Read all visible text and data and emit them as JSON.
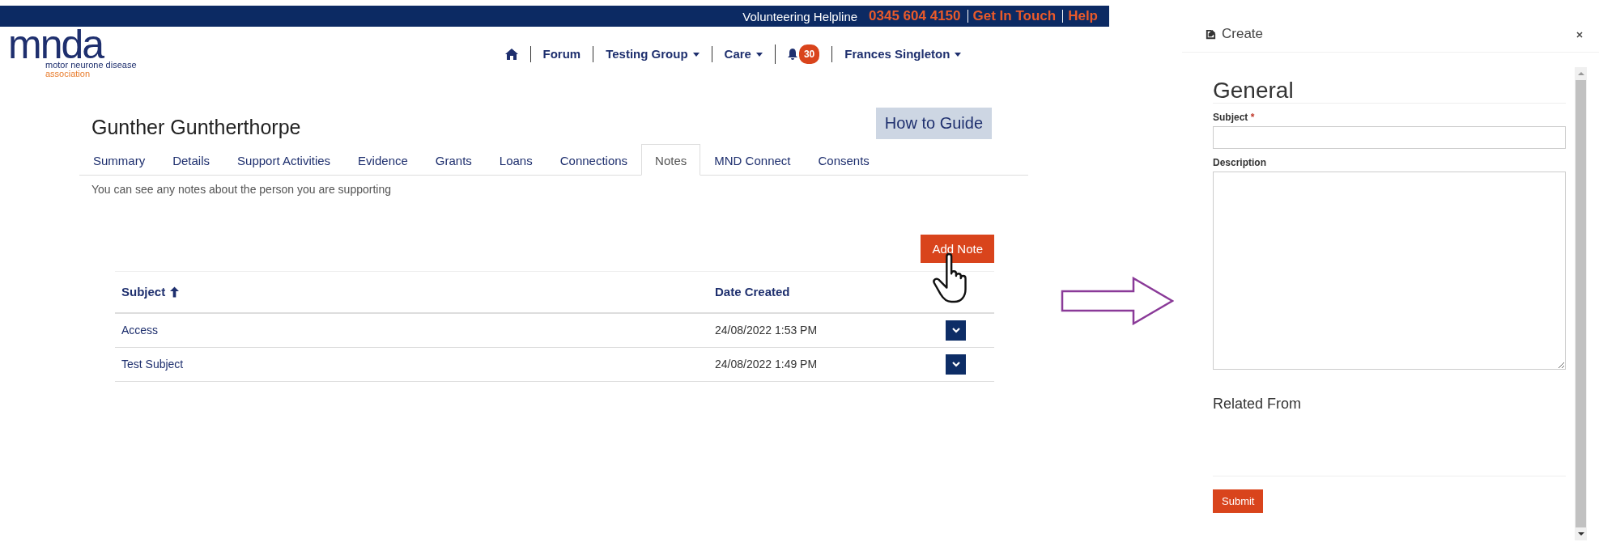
{
  "top_bar": {
    "helpline_label": "Volunteering Helpline",
    "phone": "0345 604 4150",
    "links": [
      "Get In Touch",
      "Help"
    ]
  },
  "logo": {
    "wordmark": "mnda",
    "tagline": [
      "motor neurone disease",
      "association"
    ]
  },
  "nav": [
    {
      "kind": "home"
    },
    {
      "kind": "link",
      "label": "Forum"
    },
    {
      "kind": "dropdown",
      "label": "Testing Group"
    },
    {
      "kind": "dropdown",
      "label": "Care"
    },
    {
      "kind": "notifications",
      "badge": "30"
    },
    {
      "kind": "dropdown",
      "label": "Frances Singleton"
    }
  ],
  "page": {
    "title": "Gunther Guntherthorpe",
    "guide_button": "How to Guide",
    "tabs": [
      {
        "label": "Summary",
        "selected": false
      },
      {
        "label": "Details",
        "selected": false
      },
      {
        "label": "Support Activities",
        "selected": false
      },
      {
        "label": "Evidence",
        "selected": false
      },
      {
        "label": "Grants",
        "selected": false
      },
      {
        "label": "Loans",
        "selected": false
      },
      {
        "label": "Connections",
        "selected": false
      },
      {
        "label": "Notes",
        "selected": true
      },
      {
        "label": "MND Connect",
        "selected": false
      },
      {
        "label": "Consents",
        "selected": false
      }
    ],
    "intro": "You can see any notes about the person you are supporting",
    "add_button": "Add Note",
    "table": {
      "columns": [
        {
          "label": "Subject",
          "sorted": true
        },
        {
          "label": "Date Created",
          "sorted": false
        }
      ],
      "rows": [
        {
          "subject": "Access",
          "date_created": "24/08/2022 1:53 PM"
        },
        {
          "subject": "Test Subject",
          "date_created": "24/08/2022 1:49 PM"
        }
      ]
    }
  },
  "panel": {
    "title": "Create",
    "section": "General",
    "fields": [
      {
        "kind": "input",
        "label": "Subject",
        "required_mark": "*"
      },
      {
        "kind": "textarea",
        "label": "Description"
      }
    ],
    "related_heading": "Related From",
    "submit": "Submit"
  }
}
